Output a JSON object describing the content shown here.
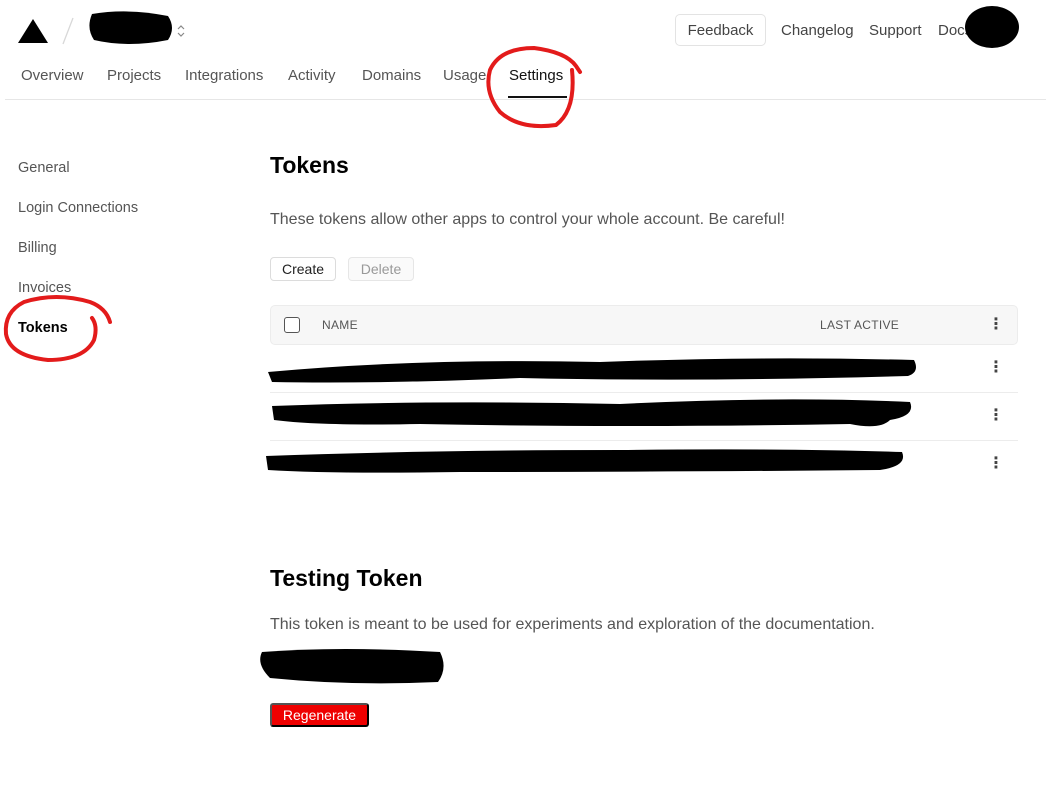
{
  "header": {
    "feedback_label": "Feedback",
    "links": [
      "Changelog",
      "Support",
      "Docs"
    ]
  },
  "nav": {
    "tabs": [
      "Overview",
      "Projects",
      "Integrations",
      "Activity",
      "Domains",
      "Usage",
      "Settings"
    ],
    "active": "Settings"
  },
  "sidebar": {
    "items": [
      "General",
      "Login Connections",
      "Billing",
      "Invoices",
      "Tokens"
    ],
    "active": "Tokens"
  },
  "tokens": {
    "title": "Tokens",
    "description": "These tokens allow other apps to control your whole account. Be careful!",
    "create_label": "Create",
    "delete_label": "Delete",
    "columns": [
      "NAME",
      "LAST ACTIVE"
    ]
  },
  "testing": {
    "title": "Testing Token",
    "description": "This token is meant to be used for experiments and exploration of the documentation.",
    "regenerate_label": "Regenerate"
  },
  "colors": {
    "danger": "#ee0000",
    "annotation": "#e31b1b",
    "redaction": "#000000"
  }
}
